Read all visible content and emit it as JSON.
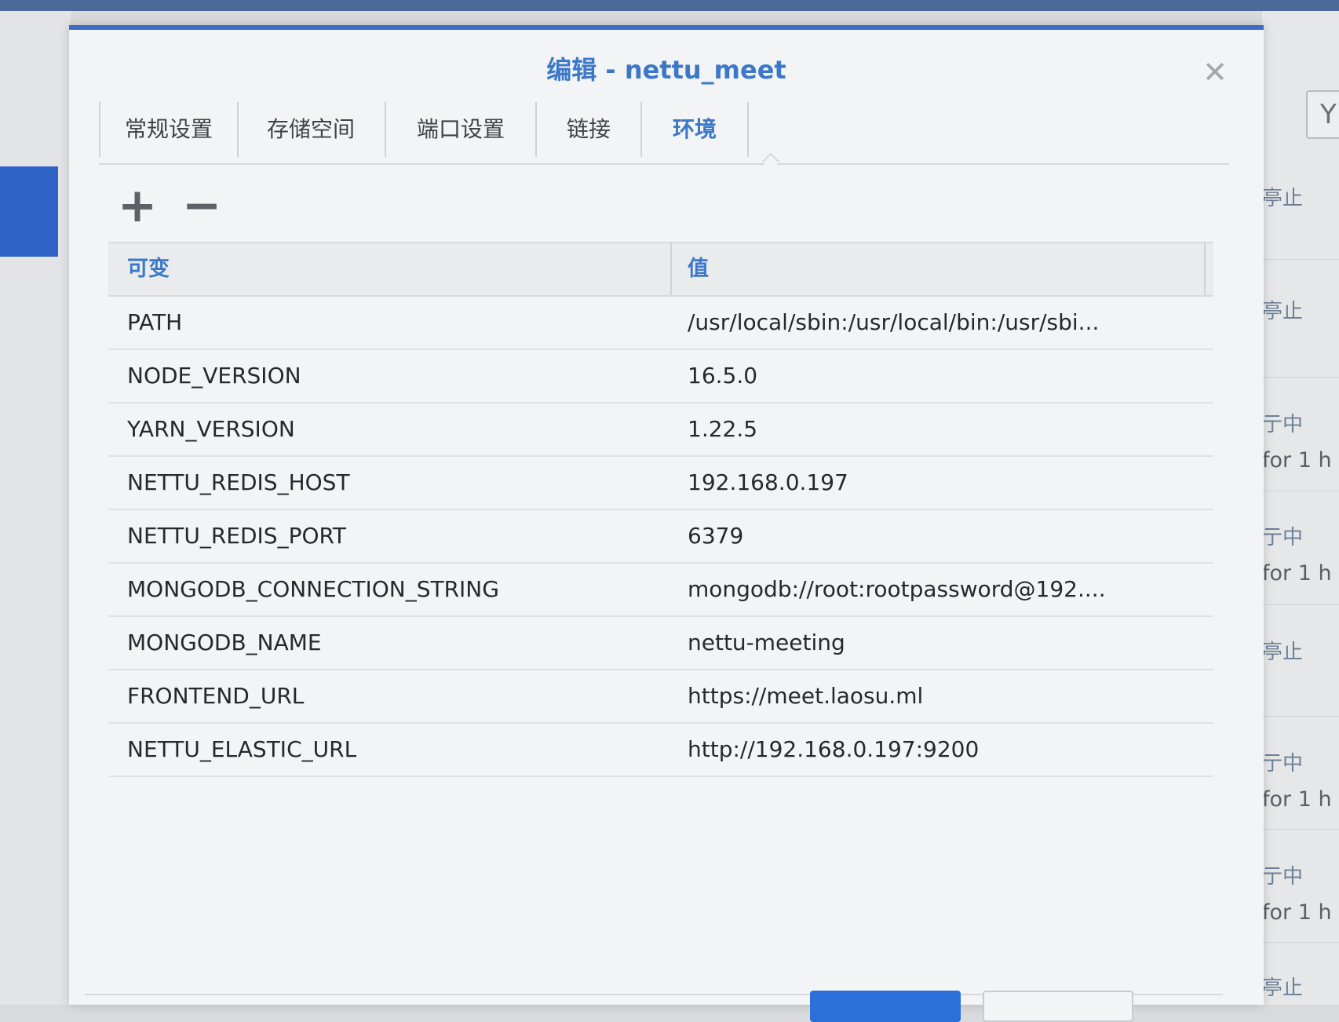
{
  "dialog": {
    "title": "编辑 - nettu_meet",
    "close_glyph": "✕"
  },
  "tabs": [
    {
      "label": "常规设置"
    },
    {
      "label": "存储空间"
    },
    {
      "label": "端口设置"
    },
    {
      "label": "链接"
    },
    {
      "label": "环境",
      "active": true
    }
  ],
  "toolbar": {
    "add_glyph": "+",
    "remove_glyph": "−"
  },
  "table": {
    "headers": [
      "可变",
      "值"
    ],
    "rows": [
      {
        "name": "PATH",
        "value": "/usr/local/sbin:/usr/local/bin:/usr/sbi..."
      },
      {
        "name": "NODE_VERSION",
        "value": "16.5.0"
      },
      {
        "name": "YARN_VERSION",
        "value": "1.22.5"
      },
      {
        "name": "NETTU_REDIS_HOST",
        "value": "192.168.0.197"
      },
      {
        "name": "NETTU_REDIS_PORT",
        "value": "6379"
      },
      {
        "name": "MONGODB_CONNECTION_STRING",
        "value": "mongodb://root:rootpassword@192...."
      },
      {
        "name": "MONGODB_NAME",
        "value": "nettu-meeting"
      },
      {
        "name": "FRONTEND_URL",
        "value": "https://meet.laosu.ml"
      },
      {
        "name": "NETTU_ELASTIC_URL",
        "value": "http://192.168.0.197:9200"
      }
    ]
  },
  "background": {
    "filter_icon": "Y",
    "statuses": [
      {
        "label": "亭止",
        "sub": ""
      },
      {
        "label": "亭止",
        "sub": ""
      },
      {
        "label": "亍中",
        "sub": "for 1 h"
      },
      {
        "label": "亍中",
        "sub": "for 1 h"
      },
      {
        "label": "亭止",
        "sub": ""
      },
      {
        "label": "亍中",
        "sub": "for 1 h"
      },
      {
        "label": "亍中",
        "sub": "for 1 h"
      },
      {
        "label": "亭止",
        "sub": ""
      }
    ]
  },
  "colors": {
    "accent": "#3c78c8",
    "dialog_border": "#3b6cc4",
    "primary_button": "#2b6fd8"
  }
}
